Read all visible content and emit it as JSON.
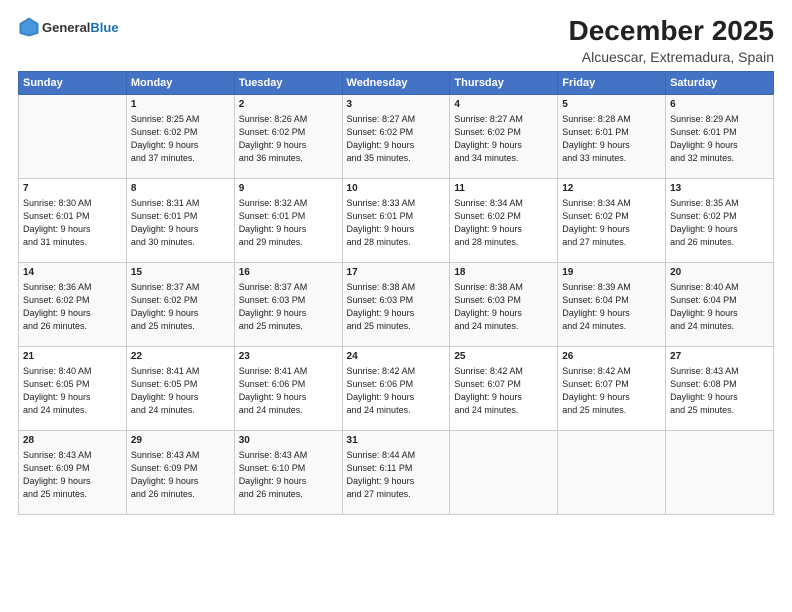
{
  "logo": {
    "general": "General",
    "blue": "Blue"
  },
  "title": "December 2025",
  "subtitle": "Alcuescar, Extremadura, Spain",
  "days_header": [
    "Sunday",
    "Monday",
    "Tuesday",
    "Wednesday",
    "Thursday",
    "Friday",
    "Saturday"
  ],
  "weeks": [
    [
      {
        "day": "",
        "info": ""
      },
      {
        "day": "1",
        "info": "Sunrise: 8:25 AM\nSunset: 6:02 PM\nDaylight: 9 hours\nand 37 minutes."
      },
      {
        "day": "2",
        "info": "Sunrise: 8:26 AM\nSunset: 6:02 PM\nDaylight: 9 hours\nand 36 minutes."
      },
      {
        "day": "3",
        "info": "Sunrise: 8:27 AM\nSunset: 6:02 PM\nDaylight: 9 hours\nand 35 minutes."
      },
      {
        "day": "4",
        "info": "Sunrise: 8:27 AM\nSunset: 6:02 PM\nDaylight: 9 hours\nand 34 minutes."
      },
      {
        "day": "5",
        "info": "Sunrise: 8:28 AM\nSunset: 6:01 PM\nDaylight: 9 hours\nand 33 minutes."
      },
      {
        "day": "6",
        "info": "Sunrise: 8:29 AM\nSunset: 6:01 PM\nDaylight: 9 hours\nand 32 minutes."
      }
    ],
    [
      {
        "day": "7",
        "info": "Sunrise: 8:30 AM\nSunset: 6:01 PM\nDaylight: 9 hours\nand 31 minutes."
      },
      {
        "day": "8",
        "info": "Sunrise: 8:31 AM\nSunset: 6:01 PM\nDaylight: 9 hours\nand 30 minutes."
      },
      {
        "day": "9",
        "info": "Sunrise: 8:32 AM\nSunset: 6:01 PM\nDaylight: 9 hours\nand 29 minutes."
      },
      {
        "day": "10",
        "info": "Sunrise: 8:33 AM\nSunset: 6:01 PM\nDaylight: 9 hours\nand 28 minutes."
      },
      {
        "day": "11",
        "info": "Sunrise: 8:34 AM\nSunset: 6:02 PM\nDaylight: 9 hours\nand 28 minutes."
      },
      {
        "day": "12",
        "info": "Sunrise: 8:34 AM\nSunset: 6:02 PM\nDaylight: 9 hours\nand 27 minutes."
      },
      {
        "day": "13",
        "info": "Sunrise: 8:35 AM\nSunset: 6:02 PM\nDaylight: 9 hours\nand 26 minutes."
      }
    ],
    [
      {
        "day": "14",
        "info": "Sunrise: 8:36 AM\nSunset: 6:02 PM\nDaylight: 9 hours\nand 26 minutes."
      },
      {
        "day": "15",
        "info": "Sunrise: 8:37 AM\nSunset: 6:02 PM\nDaylight: 9 hours\nand 25 minutes."
      },
      {
        "day": "16",
        "info": "Sunrise: 8:37 AM\nSunset: 6:03 PM\nDaylight: 9 hours\nand 25 minutes."
      },
      {
        "day": "17",
        "info": "Sunrise: 8:38 AM\nSunset: 6:03 PM\nDaylight: 9 hours\nand 25 minutes."
      },
      {
        "day": "18",
        "info": "Sunrise: 8:38 AM\nSunset: 6:03 PM\nDaylight: 9 hours\nand 24 minutes."
      },
      {
        "day": "19",
        "info": "Sunrise: 8:39 AM\nSunset: 6:04 PM\nDaylight: 9 hours\nand 24 minutes."
      },
      {
        "day": "20",
        "info": "Sunrise: 8:40 AM\nSunset: 6:04 PM\nDaylight: 9 hours\nand 24 minutes."
      }
    ],
    [
      {
        "day": "21",
        "info": "Sunrise: 8:40 AM\nSunset: 6:05 PM\nDaylight: 9 hours\nand 24 minutes."
      },
      {
        "day": "22",
        "info": "Sunrise: 8:41 AM\nSunset: 6:05 PM\nDaylight: 9 hours\nand 24 minutes."
      },
      {
        "day": "23",
        "info": "Sunrise: 8:41 AM\nSunset: 6:06 PM\nDaylight: 9 hours\nand 24 minutes."
      },
      {
        "day": "24",
        "info": "Sunrise: 8:42 AM\nSunset: 6:06 PM\nDaylight: 9 hours\nand 24 minutes."
      },
      {
        "day": "25",
        "info": "Sunrise: 8:42 AM\nSunset: 6:07 PM\nDaylight: 9 hours\nand 24 minutes."
      },
      {
        "day": "26",
        "info": "Sunrise: 8:42 AM\nSunset: 6:07 PM\nDaylight: 9 hours\nand 25 minutes."
      },
      {
        "day": "27",
        "info": "Sunrise: 8:43 AM\nSunset: 6:08 PM\nDaylight: 9 hours\nand 25 minutes."
      }
    ],
    [
      {
        "day": "28",
        "info": "Sunrise: 8:43 AM\nSunset: 6:09 PM\nDaylight: 9 hours\nand 25 minutes."
      },
      {
        "day": "29",
        "info": "Sunrise: 8:43 AM\nSunset: 6:09 PM\nDaylight: 9 hours\nand 26 minutes."
      },
      {
        "day": "30",
        "info": "Sunrise: 8:43 AM\nSunset: 6:10 PM\nDaylight: 9 hours\nand 26 minutes."
      },
      {
        "day": "31",
        "info": "Sunrise: 8:44 AM\nSunset: 6:11 PM\nDaylight: 9 hours\nand 27 minutes."
      },
      {
        "day": "",
        "info": ""
      },
      {
        "day": "",
        "info": ""
      },
      {
        "day": "",
        "info": ""
      }
    ]
  ]
}
